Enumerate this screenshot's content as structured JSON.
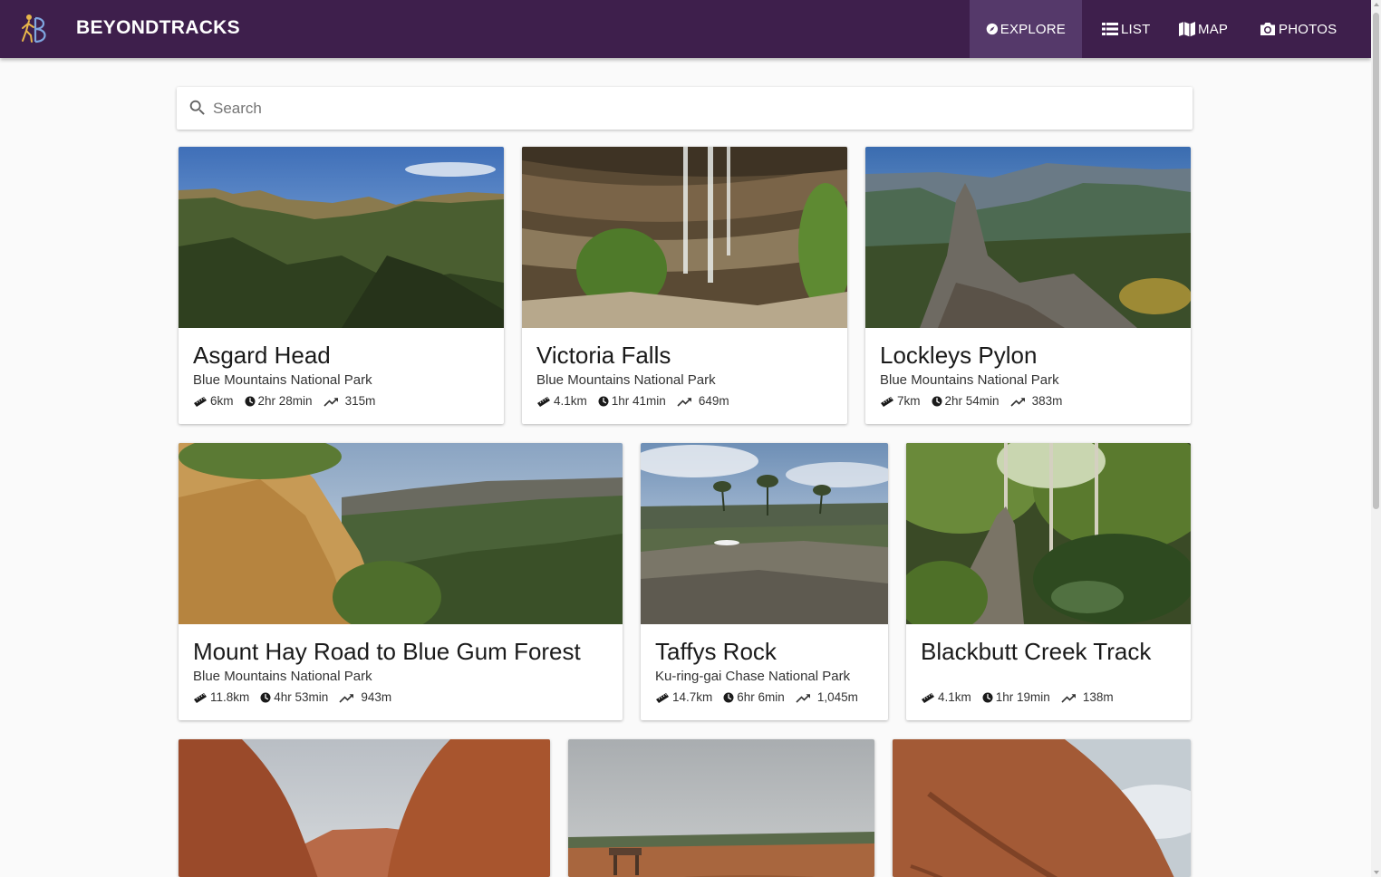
{
  "app": {
    "brand": "BEYONDTRACKS"
  },
  "nav": [
    {
      "label": "EXPLORE",
      "icon": "compass-icon",
      "active": true
    },
    {
      "label": "LIST",
      "icon": "list-icon",
      "active": false
    },
    {
      "label": "MAP",
      "icon": "map-icon",
      "active": false
    },
    {
      "label": "PHOTOS",
      "icon": "camera-icon",
      "active": false
    }
  ],
  "search": {
    "placeholder": "Search",
    "value": ""
  },
  "colors": {
    "header": "#3e1f4c",
    "header_active": "#55396a",
    "background": "#fafafa"
  },
  "cards": [
    {
      "title": "Asgard Head",
      "park": "Blue Mountains National Park",
      "distance": "6km",
      "duration": "2hr 28min",
      "elevation": "315m"
    },
    {
      "title": "Victoria Falls",
      "park": "Blue Mountains National Park",
      "distance": "4.1km",
      "duration": "1hr 41min",
      "elevation": "649m"
    },
    {
      "title": "Lockleys Pylon",
      "park": "Blue Mountains National Park",
      "distance": "7km",
      "duration": "2hr 54min",
      "elevation": "383m"
    },
    {
      "title": "Mount Hay Road to Blue Gum Forest",
      "park": "Blue Mountains National Park",
      "distance": "11.8km",
      "duration": "4hr 53min",
      "elevation": "943m"
    },
    {
      "title": "Taffys Rock",
      "park": "Ku-ring-gai Chase National Park",
      "distance": "14.7km",
      "duration": "6hr 6min",
      "elevation": "1,045m"
    },
    {
      "title": "Blackbutt Creek Track",
      "park": "",
      "distance": "4.1km",
      "duration": "1hr 19min",
      "elevation": "138m"
    },
    {
      "title": "",
      "park": "",
      "distance": "",
      "duration": "",
      "elevation": ""
    },
    {
      "title": "",
      "park": "",
      "distance": "",
      "duration": "",
      "elevation": ""
    },
    {
      "title": "",
      "park": "",
      "distance": "",
      "duration": "",
      "elevation": ""
    }
  ]
}
